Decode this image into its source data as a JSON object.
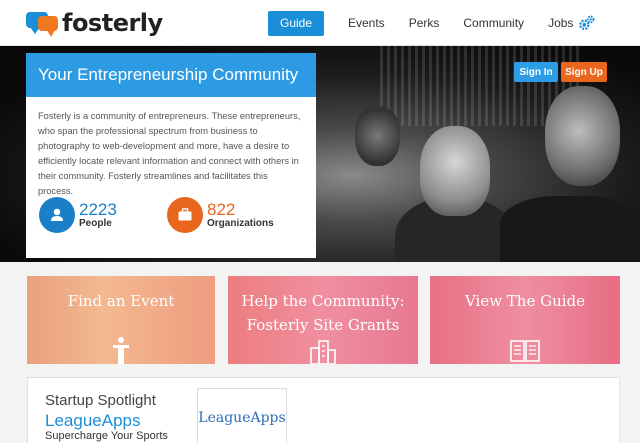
{
  "header": {
    "logo_text": "fosterly",
    "nav": {
      "guide": "Guide",
      "events": "Events",
      "perks": "Perks",
      "community": "Community",
      "jobs": "Jobs"
    }
  },
  "auth": {
    "sign_in": "Sign In",
    "sign_up": "Sign Up"
  },
  "hero": {
    "title": "Your Entrepreneurship Community",
    "description": "Fosterly is a community of entrepreneurs. These entrepreneurs, who span the professional spectrum from business to photography to web-development and more, have a desire to efficiently locate relevant information and connect with others in their community. Fosterly streamlines and facilitates this process.",
    "stats": [
      {
        "value": "2223",
        "label": "People",
        "color": "#1a7fc6",
        "icon": "person-icon"
      },
      {
        "value": "822",
        "label": "Organizations",
        "color": "#e8661e",
        "icon": "briefcase-icon"
      }
    ]
  },
  "tiles": [
    {
      "title": "Find an Event",
      "icon": "podium-icon"
    },
    {
      "title_line1": "Help the Community:",
      "title_line2": "Fosterly Site Grants",
      "icon": "buildings-icon"
    },
    {
      "title": "View The Guide",
      "icon": "book-icon"
    }
  ],
  "spotlight": {
    "label": "Startup Spotlight",
    "name": "LeagueApps",
    "tagline": "Supercharge Your Sports",
    "logo_text": "LeagueApps"
  },
  "colors": {
    "brand_blue": "#1a8fd8",
    "brand_orange": "#e8661e"
  }
}
